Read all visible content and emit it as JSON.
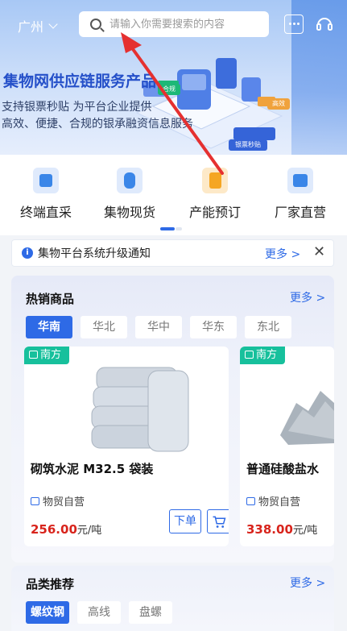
{
  "header": {
    "city": "广州",
    "search_placeholder": "请输入你需要搜索的内容"
  },
  "banner": {
    "title": "集物网供应链服务产品",
    "subtitle_line1": "支持银票秒贴 为平台企业提供",
    "subtitle_line2": "高效、便捷、合规的银承融资信息服务",
    "badges": [
      "合规",
      "高效",
      "银票秒贴"
    ]
  },
  "quick_nav": [
    {
      "label": "终端直采",
      "icon": "cart-box-icon",
      "color": "#3a86e8"
    },
    {
      "label": "集物现货",
      "icon": "database-icon",
      "color": "#3a86e8"
    },
    {
      "label": "产能预订",
      "icon": "document-icon",
      "color": "#f5a623"
    },
    {
      "label": "厂家直营",
      "icon": "inbox-icon",
      "color": "#3a86e8"
    }
  ],
  "notice": {
    "text": "集物平台系统升级通知",
    "more": "更多 >"
  },
  "hot_sale": {
    "title": "热销商品",
    "more": "更多 >",
    "regions": [
      "华南",
      "华北",
      "华中",
      "华东",
      "东北"
    ],
    "active_region": "华南",
    "products": [
      {
        "tag": "南方",
        "name": "砌筑水泥 M32.5 袋装",
        "self_op": "物贸自营",
        "price": "256.00",
        "unit": "元/吨",
        "order_btn": "下单"
      },
      {
        "tag": "南方",
        "name": "普通硅酸盐水",
        "self_op": "物贸自营",
        "price": "338.00",
        "unit": "元/吨"
      }
    ]
  },
  "category": {
    "title": "品类推荐",
    "more": "更多 >",
    "tabs": [
      "螺纹钢",
      "高线",
      "盘螺"
    ],
    "active_tab": "螺纹钢"
  },
  "colors": {
    "accent": "#2e6ae6",
    "price": "#d8241c",
    "tag": "#17c09c",
    "annotation_arrow": "#e53030"
  }
}
